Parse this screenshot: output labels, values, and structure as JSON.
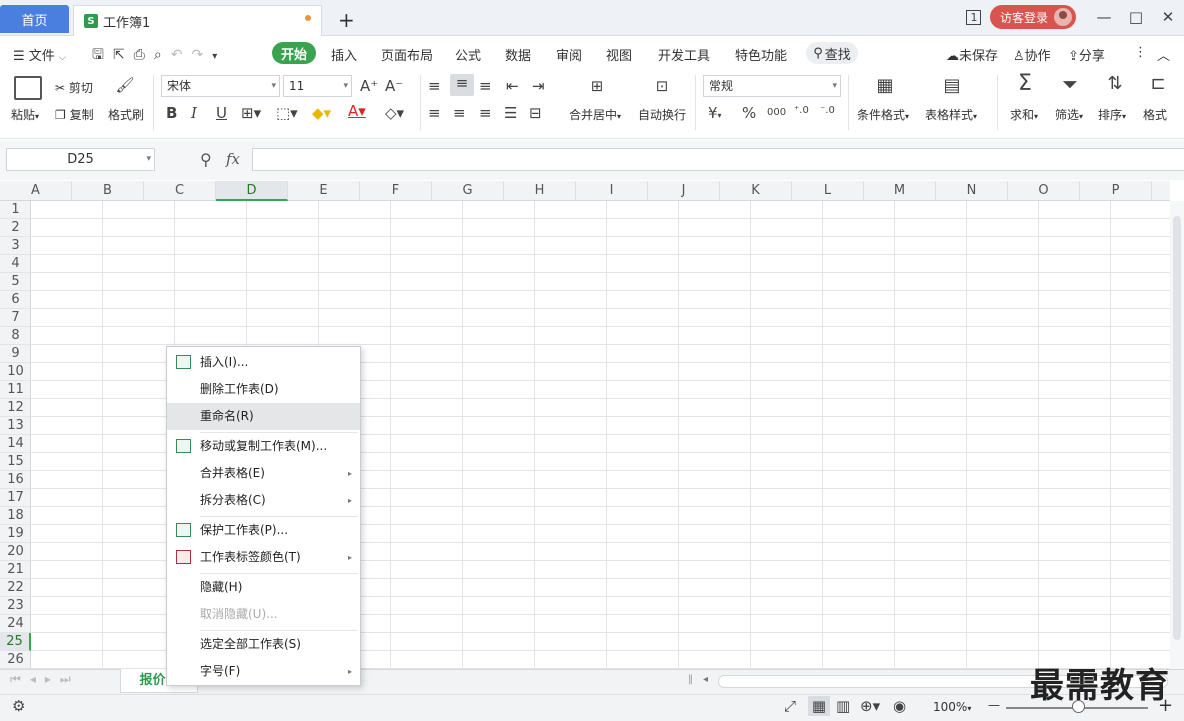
{
  "tabs": {
    "home": "首页",
    "workbook": "工作簿1",
    "add": "+"
  },
  "window": {
    "layout_badge": "1",
    "visitor": "访客登录",
    "minimize": "—",
    "maximize": "□",
    "close": "✕"
  },
  "menu": {
    "file": "文件",
    "items": [
      "开始",
      "插入",
      "页面布局",
      "公式",
      "数据",
      "审阅",
      "视图",
      "开发工具",
      "特色功能"
    ],
    "search": "查找",
    "unsaved": "未保存",
    "collab": "协作",
    "share": "分享"
  },
  "ribbon": {
    "paste": "粘贴",
    "cut": "剪切",
    "copy": "复制",
    "format_painter": "格式刷",
    "font": "宋体",
    "size": "11",
    "bold": "B",
    "italic": "I",
    "underline": "U",
    "merge": "合并居中",
    "wrap": "自动换行",
    "numfmt": "常规",
    "currency": "¥",
    "percent": "%",
    "thousands": "000",
    "cond_format": "条件格式",
    "table_style": "表格样式",
    "sum": "求和",
    "filter": "筛选",
    "sort": "排序",
    "format": "格式"
  },
  "formula": {
    "cell_ref": "D25",
    "fx": "fx"
  },
  "grid": {
    "columns": [
      "A",
      "B",
      "C",
      "D",
      "E",
      "F",
      "G",
      "H",
      "I",
      "J",
      "K",
      "L",
      "M",
      "N",
      "O",
      "P"
    ],
    "rows": [
      "1",
      "2",
      "3",
      "4",
      "5",
      "6",
      "7",
      "8",
      "9",
      "10",
      "11",
      "12",
      "13",
      "14",
      "15",
      "16",
      "17",
      "18",
      "19",
      "20",
      "21",
      "22",
      "23",
      "24",
      "25",
      "26"
    ],
    "selected_col": "D",
    "selected_row": "25"
  },
  "context_menu": {
    "items": [
      "插入(I)...",
      "删除工作表(D)",
      "重命名(R)",
      "移动或复制工作表(M)...",
      "合并表格(E)",
      "拆分表格(C)",
      "保护工作表(P)...",
      "工作表标签颜色(T)",
      "隐藏(H)",
      "取消隐藏(U)...",
      "选定全部工作表(S)",
      "字号(F)"
    ]
  },
  "sheet": {
    "tab": "报价单"
  },
  "status": {
    "zoom": "100%",
    "minus": "—",
    "plus": "+"
  },
  "watermark": "最需教育",
  "colors": {
    "accent": "#3aa34f",
    "home_tab": "#4a7fe0",
    "visitor": "#d9534f"
  }
}
